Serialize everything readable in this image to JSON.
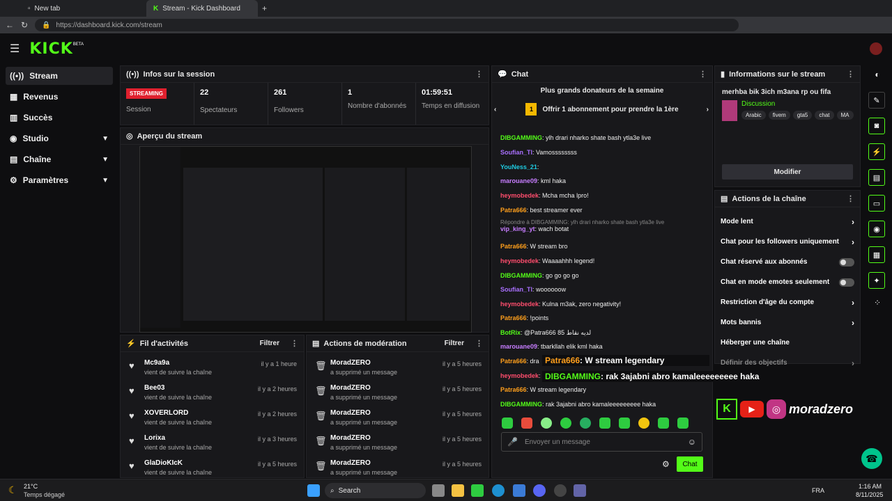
{
  "browser": {
    "tabs": [
      "New tab",
      "Stream - Kick Dashboard"
    ],
    "url": "https://dashboard.kick.com/stream"
  },
  "app": {
    "logo": "KICK",
    "beta": "BETA"
  },
  "sidebar": [
    {
      "label": "Stream",
      "icon": "broadcast-icon"
    },
    {
      "label": "Revenus",
      "icon": "money-icon"
    },
    {
      "label": "Succès",
      "icon": "trophy-icon"
    },
    {
      "label": "Studio",
      "icon": "studio-icon"
    },
    {
      "label": "Chaîne",
      "icon": "channel-icon"
    },
    {
      "label": "Paramètres",
      "icon": "gear-icon"
    }
  ],
  "session": {
    "title": "Infos sur la session",
    "badge": "STREAMING",
    "badge_label": "Session",
    "stats": [
      {
        "value": "22",
        "label": "Spectateurs"
      },
      {
        "value": "261",
        "label": "Followers"
      },
      {
        "value": "1",
        "label": "Nombre d'abonnés"
      },
      {
        "value": "01:59:51",
        "label": "Temps en diffusion"
      }
    ]
  },
  "preview": {
    "title": "Aperçu du stream"
  },
  "activity": {
    "title": "Fil d'activités",
    "filter": "Filtrer",
    "items": [
      {
        "name": "Mc9a9a",
        "sub": "vient de suivre la chaîne",
        "time": "il y a 1 heure"
      },
      {
        "name": "Bee03",
        "sub": "vient de suivre la chaîne",
        "time": "il y a 2 heures"
      },
      {
        "name": "XOVERLORD",
        "sub": "vient de suivre la chaîne",
        "time": "il y a 2 heures"
      },
      {
        "name": "Lorixa",
        "sub": "vient de suivre la chaîne",
        "time": "il y a 3 heures"
      },
      {
        "name": "GlaDioKIcK",
        "sub": "vient de suivre la chaîne",
        "time": "il y a 5 heures"
      }
    ]
  },
  "moderation": {
    "title": "Actions de modération",
    "filter": "Filtrer",
    "items": [
      {
        "name": "MoradZERO",
        "sub": "a supprimé un message",
        "time": "il y a 5 heures"
      },
      {
        "name": "MoradZERO",
        "sub": "a supprimé un message",
        "time": "il y a 5 heures"
      },
      {
        "name": "MoradZERO",
        "sub": "a supprimé un message",
        "time": "il y a 5 heures"
      },
      {
        "name": "MoradZERO",
        "sub": "a supprimé un message",
        "time": "il y a 5 heures"
      },
      {
        "name": "MoradZERO",
        "sub": "a supprimé un message",
        "time": "il y a 5 heures"
      }
    ]
  },
  "chat": {
    "title": "Chat",
    "donors_title": "Plus grands donateurs de la semaine",
    "donor_rank": "1",
    "donor_text": "Offrir 1 abonnement pour prendre la 1ère",
    "messages": [
      {
        "user": "DIBGAMMING",
        "color": "#53fc18",
        "text": "ylh drari nharko shate bash ytla3e live"
      },
      {
        "user": "Soufian_Tl",
        "color": "#a970ff",
        "text": "Vamossssssss"
      },
      {
        "user": "YouNess_21",
        "color": "#1ecbe1",
        "text": ""
      },
      {
        "user": "marouane09",
        "color": "#c77dff",
        "text": "kml haka"
      },
      {
        "user": "heymobedek",
        "color": "#ff4d6d",
        "text": "Mcha mcha lpro!"
      },
      {
        "user": "Patra666",
        "color": "#ff9f1c",
        "text": "best streamer ever"
      },
      {
        "user": "vip_king_yt",
        "color": "#c77dff",
        "text": "wach botat"
      },
      {
        "user": "Patra666",
        "color": "#ff9f1c",
        "text": "W stream bro"
      },
      {
        "user": "heymobedek",
        "color": "#ff4d6d",
        "text": "Waaaahhh legend!"
      },
      {
        "user": "DIBGAMMING",
        "color": "#53fc18",
        "text": "go go go go"
      },
      {
        "user": "Soufian_Tl",
        "color": "#a970ff",
        "text": "woooooow"
      },
      {
        "user": "heymobedek",
        "color": "#ff4d6d",
        "text": "Kulna m3ak, zero negativity!"
      },
      {
        "user": "Patra666",
        "color": "#ff9f1c",
        "text": "!points"
      },
      {
        "user": "BotRix",
        "color": "#53fc18",
        "text": "@Patra666 85 لديه نقاط"
      },
      {
        "user": "marouane09",
        "color": "#c77dff",
        "text": "tbarkllah elik kml haka"
      },
      {
        "user": "Patra666",
        "color": "#ff9f1c",
        "text": "dra"
      },
      {
        "user": "heymobedek",
        "color": "#ff4d6d",
        "text": ""
      },
      {
        "user": "Patra666",
        "color": "#ff9f1c",
        "text": "W stream legendary"
      },
      {
        "user": "DIBGAMMING",
        "color": "#53fc18",
        "text": "rak 3ajabni abro kamaleeeeeeeee haka"
      }
    ],
    "reply_label": "Répondre à DIBGAMMING: ylh drari nharko shate bash ytla3e live",
    "input_placeholder": "Envoyer un message",
    "send": "Chat"
  },
  "overlay": {
    "line1_user": "Patra666",
    "line1_text": ": W stream legendary",
    "line2_user": "DIBGAMMING",
    "line2_text": ": rak 3ajabni abro kamaleeeeeeeee haka",
    "brand": "moradzero"
  },
  "streaminfo": {
    "title": "Informations sur le stream",
    "stream_title": "merhba bik 3ich m3ana rp ou fifa",
    "category": "Discussion",
    "tags": [
      "Arabic",
      "fivem",
      "gta5",
      "chat",
      "MA"
    ],
    "edit": "Modifier"
  },
  "channel": {
    "title": "Actions de la chaîne",
    "rows": [
      {
        "label": "Mode lent",
        "type": "arrow"
      },
      {
        "label": "Chat pour les followers uniquement",
        "type": "arrow"
      },
      {
        "label": "Chat réservé aux abonnés",
        "type": "toggle"
      },
      {
        "label": "Chat en mode emotes seulement",
        "type": "toggle"
      },
      {
        "label": "Restriction d'âge du compte",
        "type": "arrow"
      },
      {
        "label": "Mots bannis",
        "type": "arrow"
      },
      {
        "label": "Héberger une chaîne",
        "type": "none"
      },
      {
        "label": "Définir des objectifs",
        "type": "arrow"
      }
    ]
  },
  "taskbar": {
    "weather_temp": "21°C",
    "weather_text": "Temps dégagé",
    "search": "Search",
    "lang": "FRA",
    "time": "1:16 AM",
    "date": "8/11/2025"
  },
  "colors": {
    "accent": "#53fc18",
    "streaming": "#e0202e"
  }
}
